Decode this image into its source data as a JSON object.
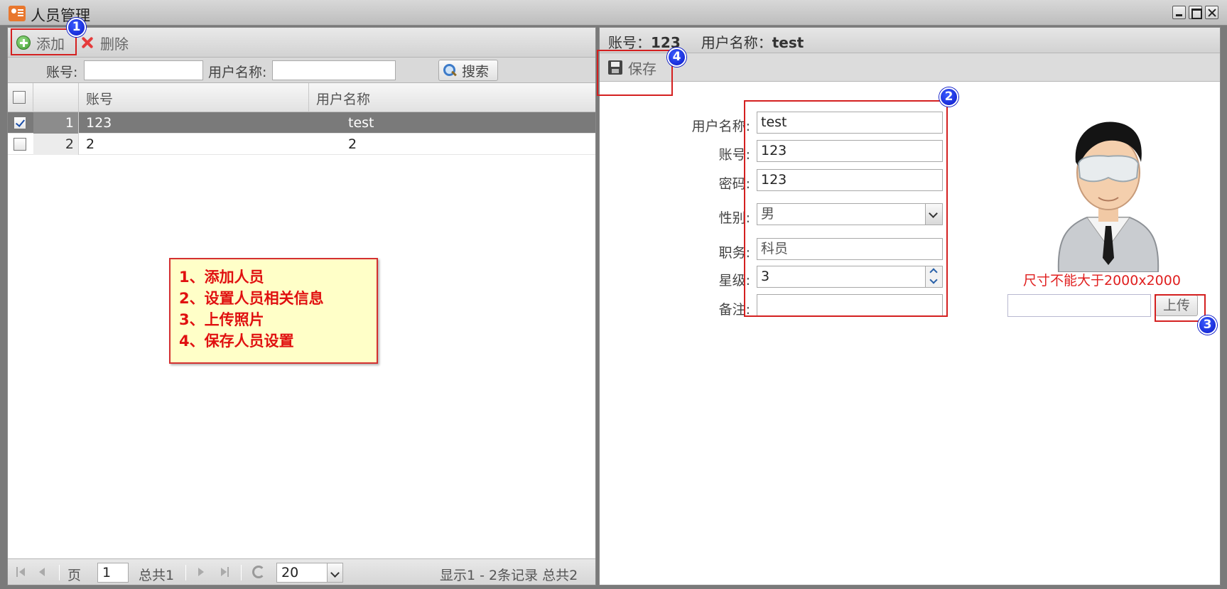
{
  "window": {
    "title": "人员管理"
  },
  "left": {
    "toolbar": {
      "add_label": "添加",
      "delete_label": "删除"
    },
    "search": {
      "account_label": "账号:",
      "account_value": "",
      "username_label": "用户名称:",
      "username_value": "",
      "button_label": "搜索"
    },
    "grid": {
      "headers": [
        "账号",
        "用户名称"
      ],
      "rows": [
        {
          "index": "1",
          "account": "123",
          "username": "test",
          "checked": true,
          "selected": true
        },
        {
          "index": "2",
          "account": "2",
          "username": "2",
          "checked": false,
          "selected": false
        }
      ]
    },
    "note": {
      "lines": [
        "1、添加人员",
        "2、设置人员相关信息",
        "3、上传照片",
        "4、保存人员设置"
      ]
    },
    "pager": {
      "page_label": "页",
      "page_value": "1",
      "total_pages": "总共1",
      "page_size": "20",
      "summary": "显示1 - 2条记录 总共2"
    }
  },
  "right": {
    "header": {
      "account_label": "账号：",
      "account_value": "123",
      "username_label": "用户名称：",
      "username_value": "test"
    },
    "toolbar": {
      "save_label": "保存"
    },
    "form": {
      "username_label": "用户名称:",
      "username_value": "test",
      "account_label": "账号:",
      "account_value": "123",
      "password_label": "密码:",
      "password_value": "123",
      "gender_label": "性别:",
      "gender_value": "男",
      "position_label": "职务:",
      "position_value": "科员",
      "rank_label": "星级:",
      "rank_value": "3",
      "remark_label": "备注:",
      "remark_value": ""
    },
    "photo": {
      "size_note": "尺寸不能大于2000x2000",
      "upload_label": "上传",
      "upload_value": ""
    }
  },
  "markers": [
    "1",
    "2",
    "3",
    "4"
  ],
  "colors": {
    "highlight": "#d42020",
    "marker": "#0a18c8",
    "note_bg": "#ffffc8",
    "note_text": "#e01010"
  }
}
